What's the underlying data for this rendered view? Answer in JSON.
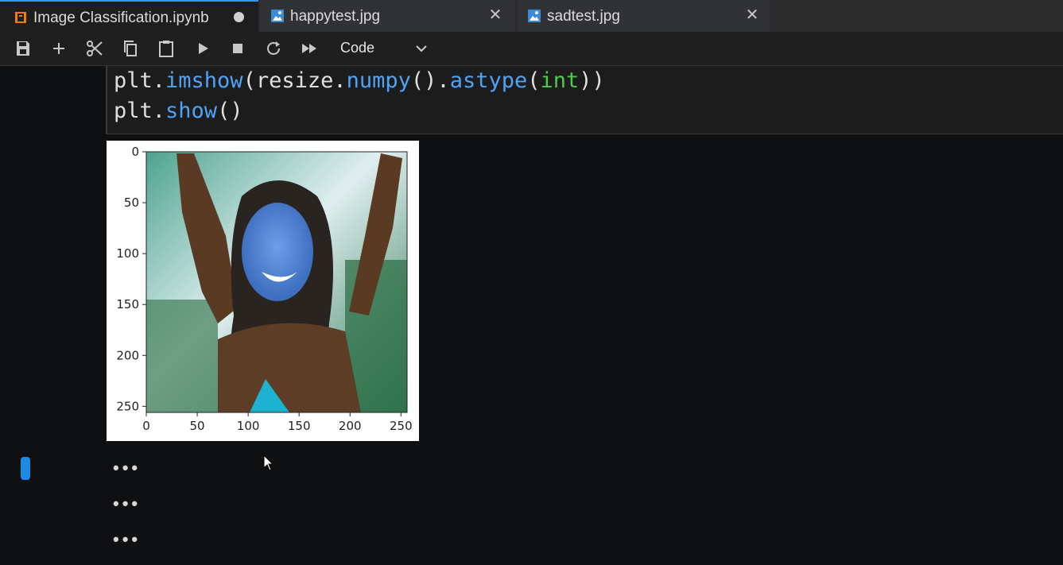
{
  "tabs": [
    {
      "label": "Image Classification.ipynb",
      "icon": "notebook-icon",
      "active": true,
      "modified": true
    },
    {
      "label": "happytest.jpg",
      "icon": "image-file-icon",
      "active": false
    },
    {
      "label": "sadtest.jpg",
      "icon": "image-file-icon",
      "active": false
    }
  ],
  "toolbar": {
    "buttons": [
      "save-icon",
      "add-cell-icon",
      "cut-icon",
      "copy-icon",
      "paste-icon",
      "run-icon",
      "stop-icon",
      "restart-icon",
      "run-all-icon"
    ],
    "cell_type": "Code"
  },
  "code": {
    "line1": {
      "a": "plt.",
      "b": "imshow",
      "c": "(resize.",
      "d": "numpy",
      "e": "().",
      "f": "astype",
      "g": "(",
      "h": "int",
      "i": "))"
    },
    "line2": {
      "a": "plt.",
      "b": "show",
      "c": "()"
    }
  },
  "chart_data": {
    "type": "image",
    "x_ticks": [
      "0",
      "50",
      "100",
      "150",
      "200",
      "250"
    ],
    "y_ticks": [
      "0",
      "50",
      "100",
      "150",
      "200",
      "250"
    ],
    "xlim": [
      0,
      256
    ],
    "ylim": [
      256,
      0
    ]
  },
  "collapsed_outputs": [
    "•••",
    "•••",
    "•••"
  ],
  "colors": {
    "accent": "#3794ff",
    "indicator": "#1e88e5"
  }
}
